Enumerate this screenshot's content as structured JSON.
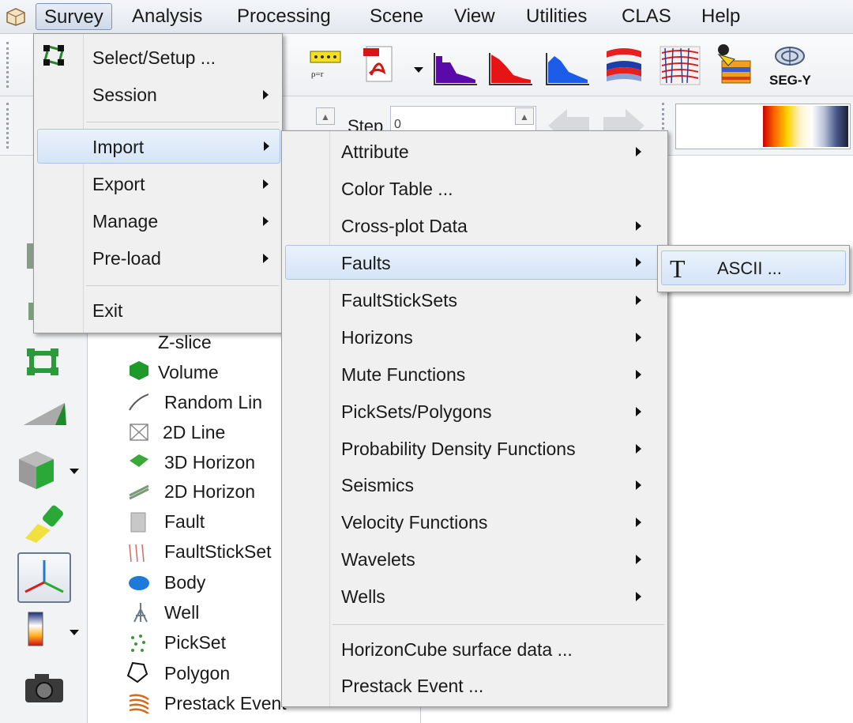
{
  "menubar": {
    "items": [
      "Survey",
      "Analysis",
      "Processing",
      "Scene",
      "View",
      "Utilities",
      "CLAS",
      "Help"
    ]
  },
  "toolbar": {
    "seg_y_label": "SEG-Y",
    "step_label": "Step",
    "step_value": "0"
  },
  "survey_menu": {
    "items": [
      {
        "label": "Select/Setup ...",
        "submenu": false
      },
      {
        "label": "Session",
        "submenu": true
      },
      {
        "label": "Import",
        "submenu": true
      },
      {
        "label": "Export",
        "submenu": true
      },
      {
        "label": "Manage",
        "submenu": true
      },
      {
        "label": "Pre-load",
        "submenu": true
      },
      {
        "label": "Exit",
        "submenu": false
      }
    ]
  },
  "import_menu": {
    "items": [
      {
        "label": "Attribute",
        "submenu": true
      },
      {
        "label": "Color Table ...",
        "submenu": false
      },
      {
        "label": "Cross-plot Data",
        "submenu": true
      },
      {
        "label": "Faults",
        "submenu": true
      },
      {
        "label": "FaultStickSets",
        "submenu": true
      },
      {
        "label": "Horizons",
        "submenu": true
      },
      {
        "label": "Mute Functions",
        "submenu": true
      },
      {
        "label": "PickSets/Polygons",
        "submenu": true
      },
      {
        "label": "Probability Density Functions",
        "submenu": true
      },
      {
        "label": "Seismics",
        "submenu": true
      },
      {
        "label": "Velocity Functions",
        "submenu": true
      },
      {
        "label": "Wavelets",
        "submenu": true
      },
      {
        "label": "Wells",
        "submenu": true
      },
      {
        "label": "HorizonCube surface data ...",
        "submenu": false
      },
      {
        "label": "Prestack Event ...",
        "submenu": false
      }
    ]
  },
  "faults_menu": {
    "items": [
      {
        "label": "ASCII ...",
        "icon_text": "T"
      }
    ]
  },
  "tree": {
    "items": [
      "Z-slice",
      "Volume",
      "Random Lin",
      "2D Line",
      "3D Horizon",
      "2D Horizon",
      "Fault",
      "FaultStickSet",
      "Body",
      "Well",
      "PickSet",
      "Polygon",
      "Prestack Event"
    ]
  },
  "colors": {
    "highlight_bg": "#d5e4f7",
    "highlight_border": "#a9c4e8",
    "menu_bg": "#f0f0f0"
  }
}
